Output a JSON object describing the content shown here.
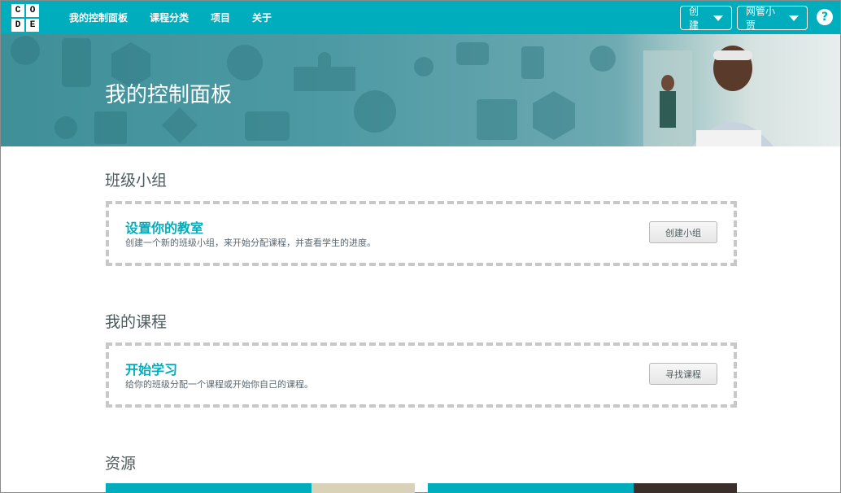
{
  "logo": {
    "letters": [
      "C",
      "O",
      "D",
      "E"
    ]
  },
  "nav": {
    "items": [
      {
        "label": "我的控制面板"
      },
      {
        "label": "课程分类"
      },
      {
        "label": "项目"
      },
      {
        "label": "关于"
      }
    ]
  },
  "header_buttons": {
    "create_label": "创建",
    "user_label": "网管小贾"
  },
  "help": {
    "symbol": "?"
  },
  "banner": {
    "title": "我的控制面板"
  },
  "sections": {
    "classrooms": {
      "title": "班级小组",
      "heading": "设置你的教室",
      "description": "创建一个新的班级小组，来开始分配课程，并查看学生的进度。",
      "button_label": "创建小组"
    },
    "courses": {
      "title": "我的课程",
      "heading": "开始学习",
      "description": "给你的班级分配一个课程或开始你自己的课程。",
      "button_label": "寻找课程"
    },
    "resources": {
      "title": "资源"
    }
  },
  "colors": {
    "brand_teal": "#00adbc",
    "dash_gray": "#c8c8c8",
    "text_dark": "#4d5b5e"
  }
}
